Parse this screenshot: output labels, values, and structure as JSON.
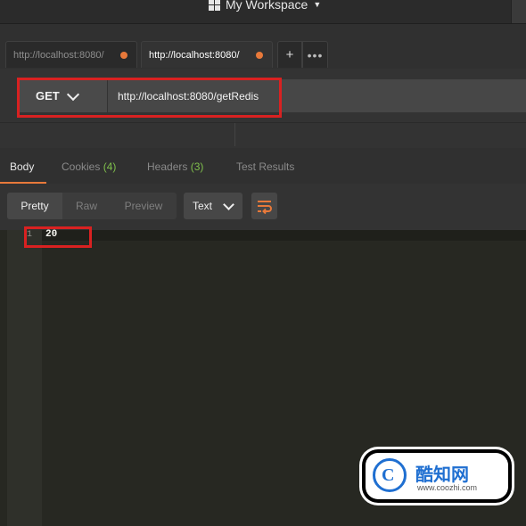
{
  "workspace": {
    "label": "My Workspace"
  },
  "tabs": [
    {
      "title": "http://localhost:8080/",
      "active": false
    },
    {
      "title": "http://localhost:8080/",
      "active": true
    }
  ],
  "tab_actions": {
    "add": "+",
    "more": "•••"
  },
  "request": {
    "method": "GET",
    "url": "http://localhost:8080/getRedis"
  },
  "response_tabs": [
    {
      "label": "Body",
      "count": ""
    },
    {
      "label": "Cookies",
      "count": "(4)"
    },
    {
      "label": "Headers",
      "count": "(3)"
    },
    {
      "label": "Test Results",
      "count": ""
    }
  ],
  "view_modes": [
    "Pretty",
    "Raw",
    "Preview"
  ],
  "format": "Text",
  "editor": {
    "lines": [
      {
        "number": "1",
        "text": "20"
      }
    ]
  },
  "watermark": {
    "title": "酷知网",
    "url": "www.coozhi.com",
    "logo": "C"
  },
  "colors": {
    "accent": "#e8793a",
    "highlight": "#d92121",
    "count": "#7fbf4c"
  }
}
